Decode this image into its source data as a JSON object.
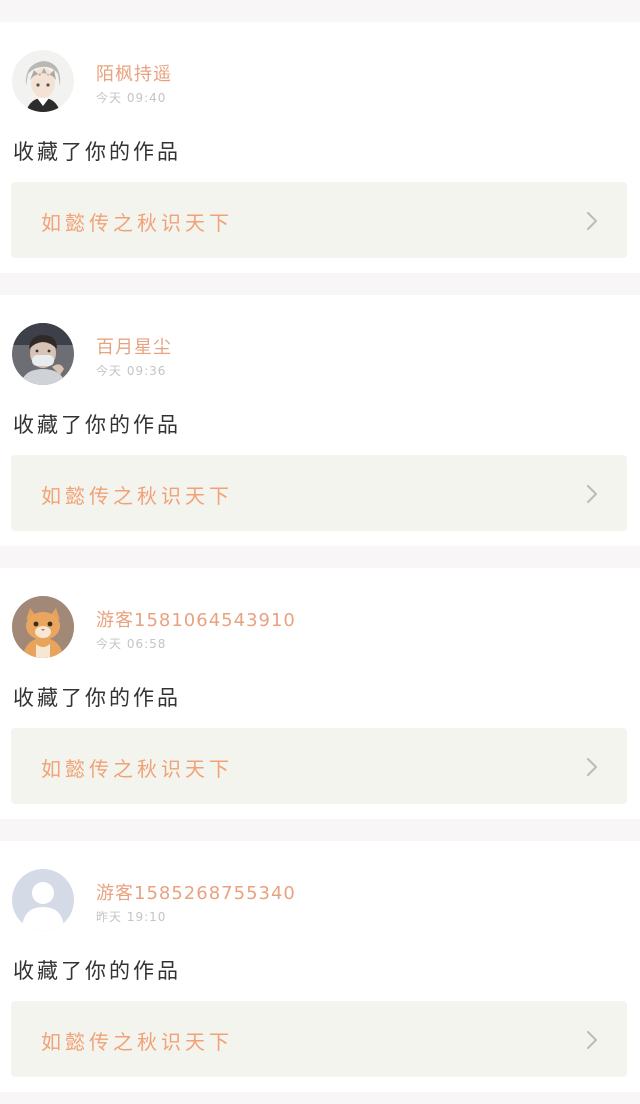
{
  "feed": [
    {
      "username": "陌枫持遥",
      "time": "今天 09:40",
      "action": "收藏了你的作品",
      "work_title": "如懿传之秋识天下",
      "avatar_icon": "anime-boy-avatar"
    },
    {
      "username": "百月星尘",
      "time": "今天 09:36",
      "action": "收藏了你的作品",
      "work_title": "如懿传之秋识天下",
      "avatar_icon": "masked-person-avatar"
    },
    {
      "username": "游客1581064543910",
      "time": "今天 06:58",
      "action": "收藏了你的作品",
      "work_title": "如懿传之秋识天下",
      "avatar_icon": "orange-cat-avatar"
    },
    {
      "username": "游客1585268755340",
      "time": "昨天 19:10",
      "action": "收藏了你的作品",
      "work_title": "如懿传之秋识天下",
      "avatar_icon": "default-user-avatar"
    }
  ],
  "colors": {
    "username": "#e9a27f",
    "work_title": "#f0a276",
    "link_bg": "#f4f4ef",
    "separator": "#f8f6f7"
  }
}
